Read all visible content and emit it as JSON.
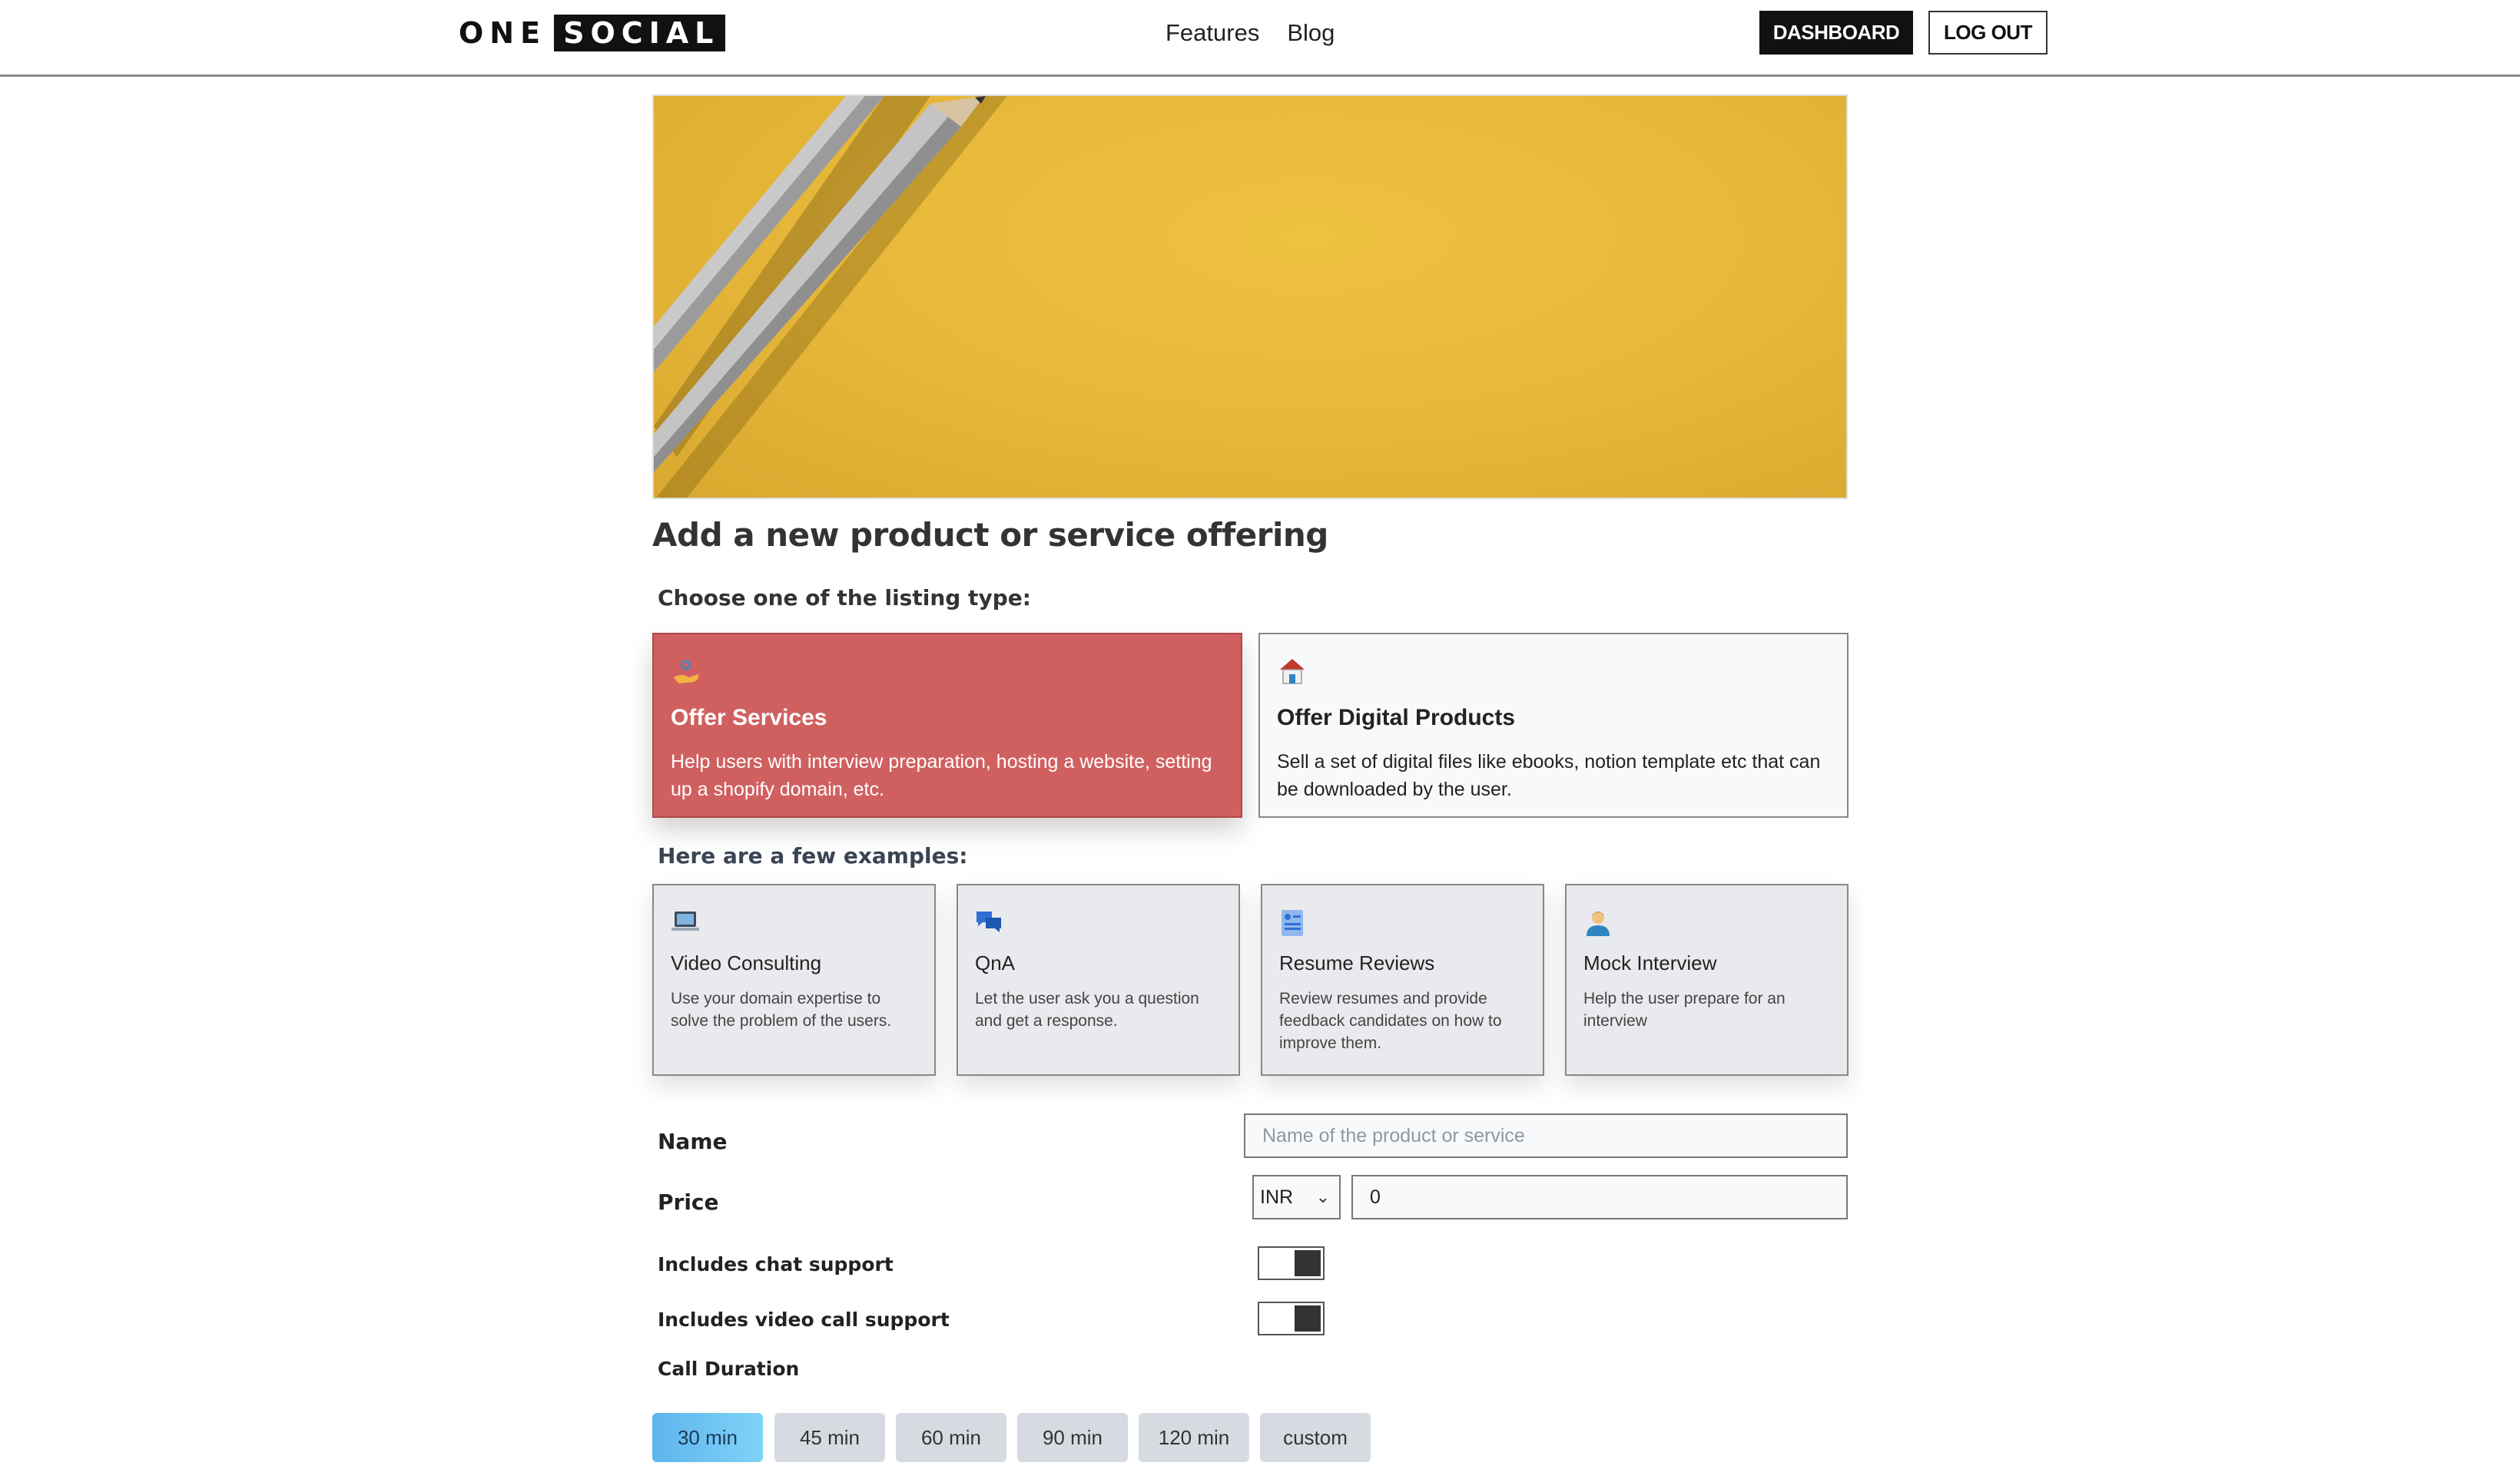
{
  "header": {
    "logo_part1": "ONE",
    "logo_part2": "SOCIAL",
    "nav": [
      "Features",
      "Blog"
    ],
    "dashboard_label": "DASHBOARD",
    "logout_label": "LOG OUT"
  },
  "banner": {
    "image": "pencils-on-yellow-background"
  },
  "page_title": "Add a new product or service offering",
  "listing_type_heading": "Choose one of the listing type:",
  "listing_types": [
    {
      "icon": "hand-gear-icon",
      "title": "Offer Services",
      "desc": "Help users with interview preparation, hosting a website, setting up a shopify domain, etc.",
      "selected": true
    },
    {
      "icon": "house-icon",
      "title": "Offer Digital Products",
      "desc": "Sell a set of digital files like ebooks, notion template etc that can be downloaded by the user.",
      "selected": false
    }
  ],
  "examples_heading": "Here are a few examples:",
  "examples": [
    {
      "icon": "laptop-icon",
      "title": "Video Consulting",
      "desc": "Use your domain expertise to solve the problem of the users."
    },
    {
      "icon": "chat-bubbles-icon",
      "title": "QnA",
      "desc": "Let the user ask you a question and get a response."
    },
    {
      "icon": "document-icon",
      "title": "Resume Reviews",
      "desc": "Review resumes and provide feedback candidates on how to improve them."
    },
    {
      "icon": "person-icon",
      "title": "Mock Interview",
      "desc": "Help the user prepare for an interview"
    }
  ],
  "form": {
    "name_label": "Name",
    "name_placeholder": "Name of the product or service",
    "price_label": "Price",
    "currency": "INR",
    "price_value": "0",
    "chat_support_label": "Includes chat support",
    "video_support_label": "Includes video call support",
    "chat_support_on": true,
    "video_support_on": true,
    "call_duration_label": "Call Duration",
    "durations": [
      "30 min",
      "45 min",
      "60 min",
      "90 min",
      "120 min",
      "custom"
    ],
    "selected_duration": "30 min"
  },
  "colors": {
    "selected_card": "#d06060",
    "active_chip": "#6cc4f2",
    "banner": "#e8b93a"
  }
}
